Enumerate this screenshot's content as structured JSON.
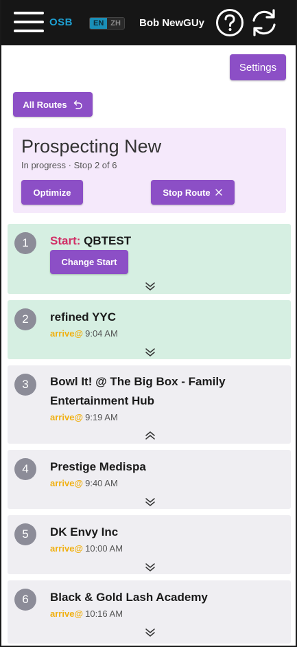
{
  "header": {
    "brand": "OSB",
    "lang_active": "EN",
    "lang_other": "ZH",
    "username": "Bob NewGUy",
    "icons": [
      "menu-icon",
      "help-icon",
      "sync-icon"
    ]
  },
  "toolbar": {
    "settings_label": "Settings",
    "all_routes_label": "All Routes"
  },
  "route": {
    "title": "Prospecting New",
    "status": "In progress · Stop 2 of 6",
    "optimize_label": "Optimize",
    "stop_route_label": "Stop Route"
  },
  "stops": [
    {
      "number": "1",
      "start_prefix": "Start:",
      "name": "QBTEST",
      "change_start_label": "Change Start",
      "state": "completed"
    },
    {
      "number": "2",
      "name": "refined YYC",
      "arrive_label": "arrive@",
      "arrive_time": "9:04 AM",
      "state": "completed"
    },
    {
      "number": "3",
      "name_line1": "Bowl It! @ The Big Box - Family",
      "name_line2": "Entertainment Hub",
      "arrive_label": "arrive@",
      "arrive_time": "9:19 AM",
      "state": "expanded"
    },
    {
      "number": "4",
      "name": "Prestige Medispa",
      "arrive_label": "arrive@",
      "arrive_time": "9:40 AM",
      "state": "pending"
    },
    {
      "number": "5",
      "name": "DK Envy Inc",
      "arrive_label": "arrive@",
      "arrive_time": "10:00 AM",
      "state": "pending"
    },
    {
      "number": "6",
      "name": "Black & Gold Lash Academy",
      "arrive_label": "arrive@",
      "arrive_time": "10:16 AM",
      "state": "pending"
    }
  ],
  "colors": {
    "accent": "#8c4fc6",
    "header_bg": "#161616",
    "brand": "#1e9fd1",
    "completed_bg": "#d6efe2",
    "pending_bg": "#efeef2",
    "route_card_bg": "#f5e9fb",
    "start_label": "#d12f66",
    "arrive_label": "#f0b011"
  }
}
